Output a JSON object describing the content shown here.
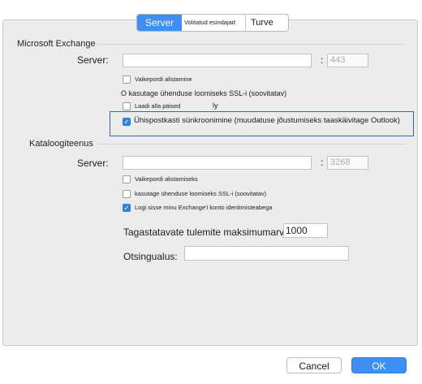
{
  "tabs": [
    "Server",
    "Volitatud esindajad",
    "Turve"
  ],
  "exchange": {
    "section_title": "Microsoft Exchange",
    "server_label": "Server:",
    "server_value": "",
    "colon": ":",
    "port_value": "443",
    "override_port": "Vaikepordi alistamine",
    "ssl": "O kasutage ühenduse loomiseks SSL-i (soovitatav)",
    "headers_only": "Laadi alla päised",
    "headers_suffix": "ly",
    "sync_mailboxes": "Ühispostkasti sünkroonimine (muudatuse jõustumiseks taaskäivitage Outlook)"
  },
  "directory": {
    "section_title": "Kataloogiteenus",
    "server_label": "Server:",
    "server_value": "",
    "colon": ":",
    "port_value": "3268",
    "override_port": "Vaikepordi alistamiseks",
    "ssl": "kasutage ühenduse loomiseks SSL-i (soovitatav)",
    "use_credentials": "Logi sisse minu Exchange'i konto identimisteabega",
    "max_results_label": "Tagastatavate tulemite maksimumarv:",
    "max_results_value": "1000",
    "search_base_label": "Otsingualus:",
    "search_base_value": ""
  },
  "checkboxes": {
    "exchange_override_port": false,
    "exchange_ssl": false,
    "exchange_headers_only": false,
    "exchange_sync_mailboxes": true,
    "directory_override_port": false,
    "directory_ssl": false,
    "directory_use_credentials": true
  },
  "buttons": {
    "cancel": "Cancel",
    "ok": "OK"
  },
  "colors": {
    "accent": "#3d8ff5",
    "highlight_border": "#3b5cc9"
  }
}
